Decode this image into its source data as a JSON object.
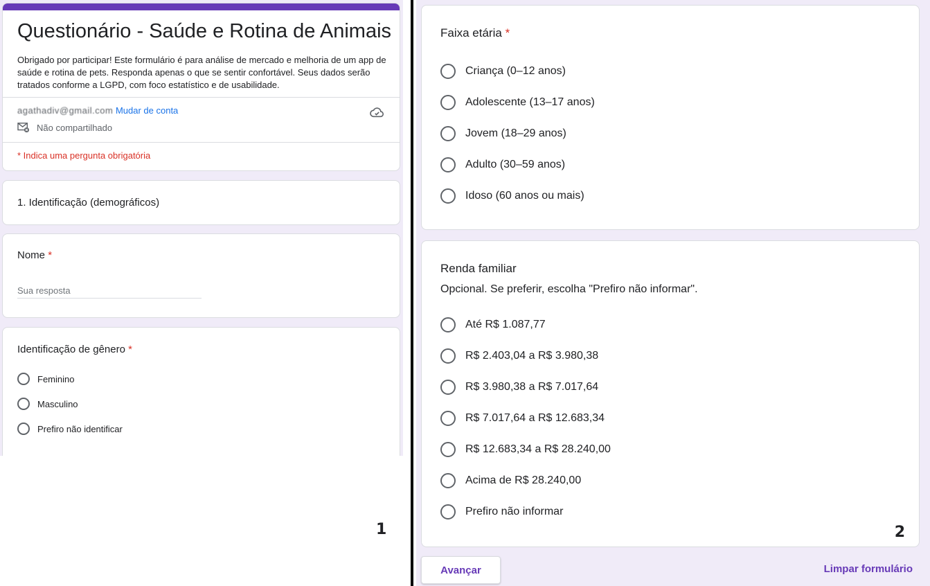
{
  "left": {
    "header": {
      "title": "Questionário - Saúde e Rotina de Animais",
      "description": "Obrigado por participar! Este formulário é para análise de mercado e melhoria de um app de saúde e rotina de pets. Responda apenas o que se sentir confortável. Seus dados serão tratados conforme a LGPD, com foco estatístico e de usabilidade.",
      "account_email": "agathadiv@gmail.com",
      "switch_account": "Mudar de conta",
      "not_shared": "Não compartilhado",
      "required_note": "* Indica uma pergunta obrigatória"
    },
    "section_title": "1. Identificação (demográficos)",
    "name_question": {
      "label": "Nome",
      "required_mark": "*",
      "placeholder": "Sua resposta"
    },
    "gender_question": {
      "label": "Identificação de gênero",
      "required_mark": "*",
      "options": [
        "Feminino",
        "Masculino",
        "Prefiro não identificar"
      ]
    },
    "panel_label": "1"
  },
  "right": {
    "age_question": {
      "label": "Faixa etária",
      "required_mark": "*",
      "options": [
        "Criança (0–12 anos)",
        "Adolescente (13–17 anos)",
        "Jovem (18–29 anos)",
        "Adulto (30–59 anos)",
        "Idoso (60 anos ou mais)"
      ]
    },
    "income_question": {
      "label": "Renda familiar",
      "description": "Opcional. Se preferir, escolha \"Prefiro não informar\".",
      "options": [
        "Até R$ 1.087,77",
        "R$ 2.403,04 a R$ 3.980,38",
        "R$ 3.980,38 a R$ 7.017,64",
        "R$ 7.017,64 a R$ 12.683,34",
        "R$ 12.683,34 a R$ 28.240,00",
        "Acima de R$ 28.240,00",
        "Prefiro não informar"
      ]
    },
    "panel_label": "2",
    "next_button": "Avançar",
    "clear_form": "Limpar formulário"
  },
  "colors": {
    "accent": "#673ab7",
    "background": "#f0ebf8",
    "required": "#d93025",
    "link": "#1a73e8"
  }
}
